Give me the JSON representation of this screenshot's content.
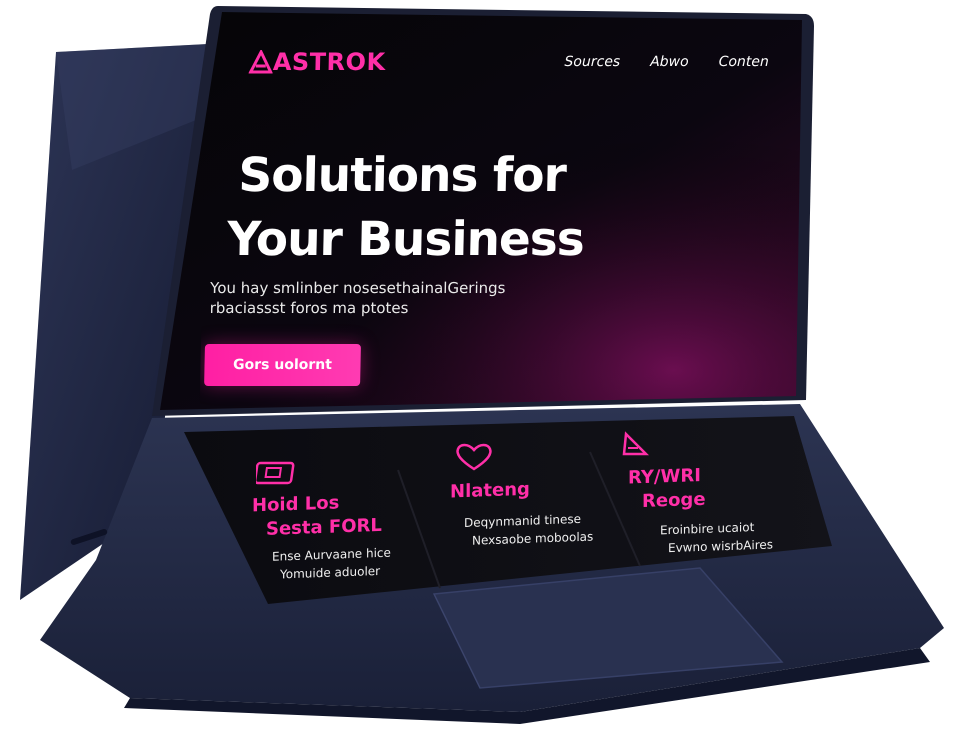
{
  "site": {
    "brand": "ASTROK"
  },
  "nav": {
    "items": [
      "Sources",
      "Abwo",
      "Conten"
    ]
  },
  "hero": {
    "title_line1": "Solutions for",
    "title_line2": "Your Business",
    "copy_line1": "You hay smlinber nosesethainalGerings",
    "copy_line2": "rbaciassst foros ma ptotes",
    "cta_label": "Gors uolornt"
  },
  "cards": [
    {
      "title_line1": "Hoid Los",
      "title_line2": "Sesta FORL",
      "sub_line1": "Ense Aurvaane hice",
      "sub_line2": "Yomuide aduoler",
      "icon": "ticket-icon"
    },
    {
      "title_line1": "Nlateng",
      "title_line2": "",
      "sub_line1": "Deqynmanid tinese",
      "sub_line2": "Nexsaobe moboolas",
      "icon": "heart-icon"
    },
    {
      "title_line1": "RY/WRI",
      "title_line2": "Reoge",
      "sub_line1": "Eroinbire ucaiot",
      "sub_line2": "Evwno wisrbAires",
      "icon": "pyramid-icon"
    }
  ],
  "colors": {
    "accent": "#ff2fa8",
    "screen_bg": "#060608",
    "device_body": "#232a45",
    "device_shadow": "#0f1428"
  }
}
